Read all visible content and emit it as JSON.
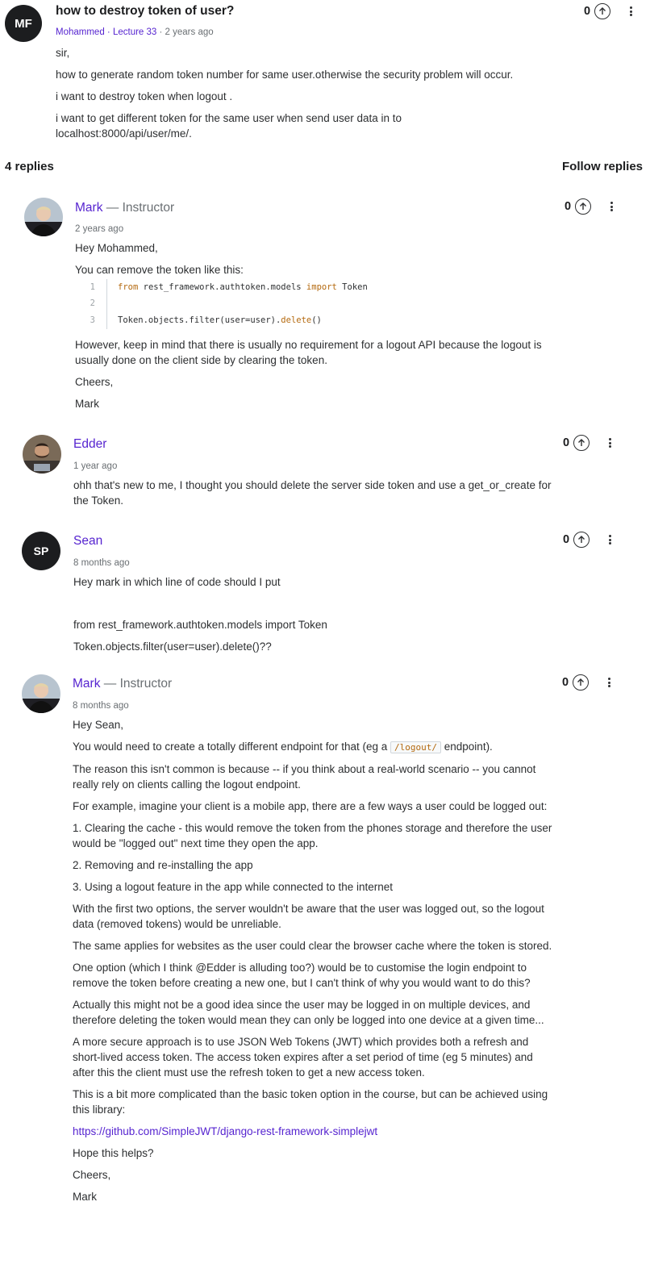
{
  "question": {
    "avatar_initials": "MF",
    "title": "how to destroy token of user?",
    "author": "Mohammed",
    "lecture": "Lecture 33",
    "time": "2 years ago",
    "votes": "0",
    "body": [
      "sir,",
      "how to generate random token number for same user.otherwise the security problem will occur.",
      "i want to destroy token when logout .",
      "i want to get different token for the same user when send user data in to localhost:8000/api/user/me/."
    ]
  },
  "replies_header": {
    "count_label": "4 replies",
    "follow_label": "Follow replies"
  },
  "replies": [
    {
      "name": "Mark",
      "role": "— Instructor",
      "time": "2 years ago",
      "votes": "0",
      "greeting": "Hey Mohammed,",
      "intro": "You can remove the token like this:",
      "code": {
        "line_numbers": [
          "1",
          "2",
          "3"
        ],
        "kw_from": "from",
        "module": " rest_framework.authtoken.models ",
        "kw_import": "import",
        "name": " Token",
        "call_prefix": "Token.objects.filter(user=user).",
        "call_method": "delete",
        "call_suffix": "()"
      },
      "p1": "However, keep in mind that there is usually no requirement for a logout API because the logout is usually done on the client side by clearing the token.",
      "p2": "Cheers,",
      "p3": "Mark"
    },
    {
      "name": "Edder",
      "time": "1 year ago",
      "votes": "0",
      "p1": "ohh that's new to me, I thought you should delete the server side token and use a get_or_create for the Token."
    },
    {
      "name": "Sean",
      "avatar_initials": "SP",
      "time": "8 months ago",
      "votes": "0",
      "p1": "Hey mark in which line of code should I put",
      "p2": "from rest_framework.authtoken.models import Token",
      "p3": "Token.objects.filter(user=user).delete()??"
    },
    {
      "name": "Mark",
      "role": "— Instructor",
      "time": "8 months ago",
      "votes": "0",
      "greeting": "Hey Sean,",
      "p1_before": "You would need to create a totally different endpoint for that (eg a ",
      "p1_code": "/logout/",
      "p1_after": " endpoint).",
      "p2": "The reason this isn't common is because -- if you think about a real-world scenario -- you cannot really rely on clients calling the logout endpoint.",
      "p3": "For example, imagine your client is a mobile app, there are a few ways a user could be logged out:",
      "p4": "1. Clearing the cache - this would remove the token from the phones storage and therefore the user would be \"logged out\" next time they open the app.",
      "p5": "2. Removing and re-installing the app",
      "p6": "3. Using a logout feature in the app while connected to the internet",
      "p7": "With the first two options, the server wouldn't be aware that the user was logged out, so the logout data (removed tokens) would be unreliable.",
      "p8": "The same applies for websites as the user could clear the browser cache where the token is stored.",
      "p9": "One option (which I think @Edder is alluding too?) would be to customise the login endpoint to remove the token before creating a new one, but I can't think of why you would want to do this?",
      "p10": "Actually this might not be a good idea since the user may be logged in on multiple devices, and therefore deleting the token would mean they can only be logged into one device at a given time...",
      "p11": "A more secure approach is to use JSON Web Tokens (JWT) which provides both a refresh and short-lived access token. The access token expires after a set period of time (eg 5 minutes) and after this the client must use the refresh token to get a new access token.",
      "p12": "This is a bit more complicated than the basic token option in the course, but can be achieved using this library:",
      "link": "https://github.com/SimpleJWT/django-rest-framework-simplejwt",
      "p13": "Hope this helps?",
      "p14": "Cheers,",
      "p15": "Mark"
    }
  ],
  "colors": {
    "accent": "#5624d0",
    "muted": "#6a6f73",
    "text": "#2d2f31",
    "code_keyword": "#b4690e"
  },
  "icons": {
    "upvote": "arrow-up-circle-icon",
    "more": "more-vertical-icon"
  }
}
